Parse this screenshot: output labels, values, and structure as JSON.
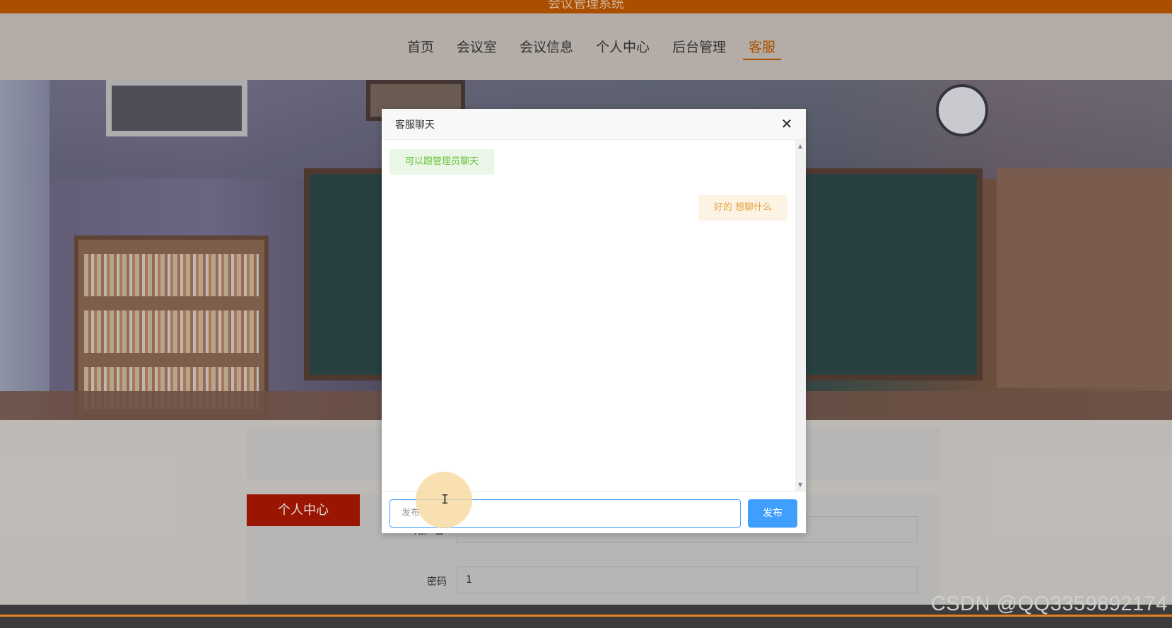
{
  "app": {
    "title": "会议管理系统"
  },
  "nav": {
    "items": [
      {
        "label": "首页"
      },
      {
        "label": "会议室"
      },
      {
        "label": "会议信息"
      },
      {
        "label": "个人中心"
      },
      {
        "label": "后台管理"
      },
      {
        "label": "客服"
      }
    ],
    "active_index": 5
  },
  "sidebar": {
    "button_label": "个人中心"
  },
  "form": {
    "username_label": "用户名",
    "password_label": "密码",
    "password_value": "1"
  },
  "modal": {
    "title": "客服聊天",
    "close_icon": "close-icon",
    "messages": [
      {
        "side": "left",
        "text": "可以跟管理员聊天"
      },
      {
        "side": "right",
        "text": "好的 想聊什么"
      }
    ],
    "input_placeholder": "发布",
    "send_label": "发布"
  },
  "watermark": "CSDN @QQ3359892174",
  "colors": {
    "brand": "#c55a00",
    "primary": "#409eff",
    "side_button": "#b11a04"
  }
}
